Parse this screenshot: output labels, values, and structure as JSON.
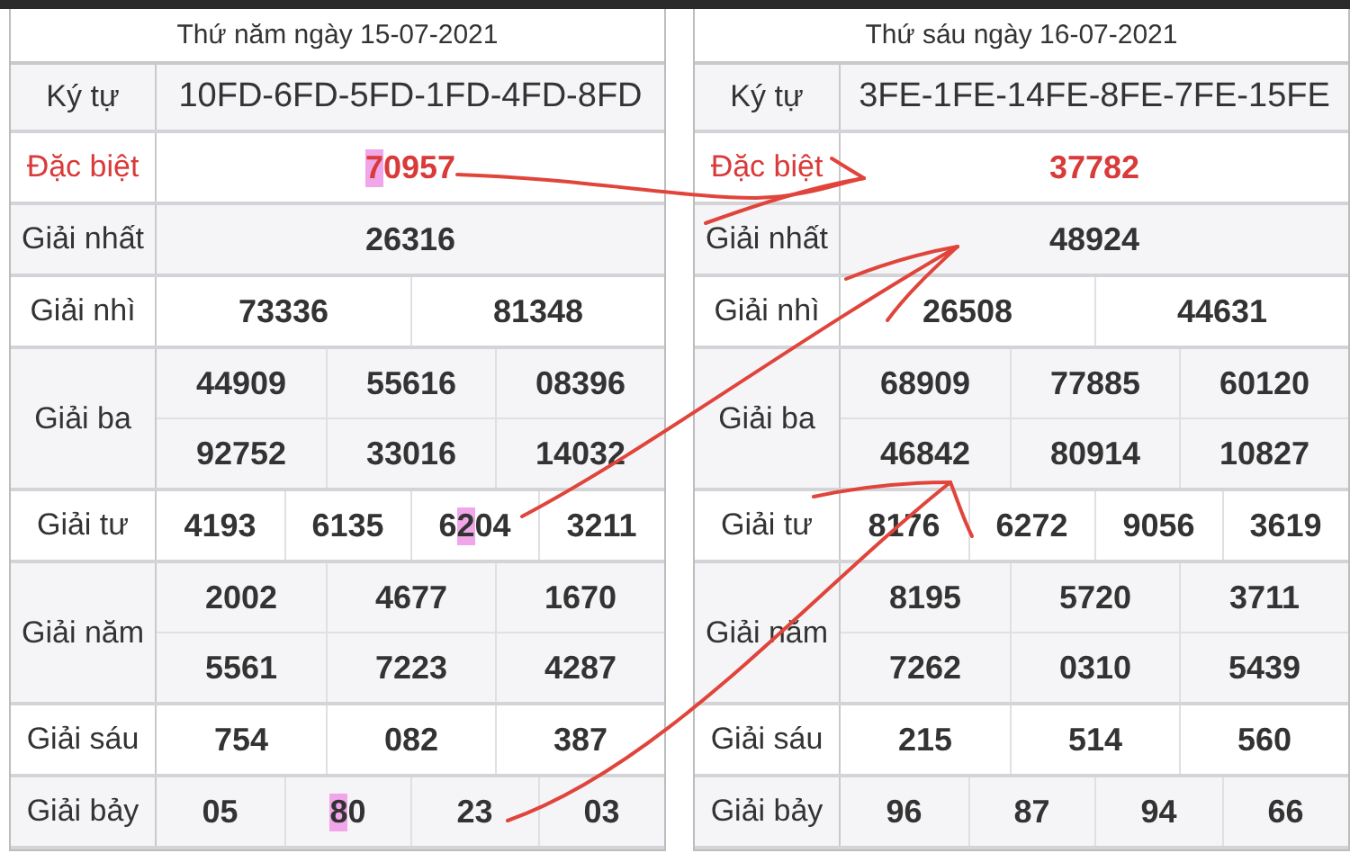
{
  "days": [
    {
      "title": "Thứ năm ngày 15-07-2021",
      "rows": [
        {
          "label": "Ký tự",
          "kind": "code",
          "lines": [
            [
              "10FD-6FD-5FD-1FD-4FD-8FD"
            ]
          ]
        },
        {
          "label": "Đặc biệt",
          "kind": "special",
          "lines": [
            [
              {
                "segments": [
                  {
                    "text": "7",
                    "highlighted": true
                  },
                  {
                    "text": "0957",
                    "highlighted": false
                  }
                ]
              }
            ]
          ]
        },
        {
          "label": "Giải nhất",
          "kind": "prize",
          "lines": [
            [
              "26316"
            ]
          ]
        },
        {
          "label": "Giải nhì",
          "kind": "prize",
          "lines": [
            [
              "73336",
              "81348"
            ]
          ]
        },
        {
          "label": "Giải ba",
          "kind": "prize",
          "lines": [
            [
              "44909",
              "55616",
              "08396"
            ],
            [
              "92752",
              "33016",
              "14032"
            ]
          ]
        },
        {
          "label": "Giải tư",
          "kind": "prize",
          "lines": [
            [
              "4193",
              "6135",
              {
                "segments": [
                  {
                    "text": "6",
                    "highlighted": false
                  },
                  {
                    "text": "2",
                    "highlighted": true
                  },
                  {
                    "text": "04",
                    "highlighted": false
                  }
                ]
              },
              "3211"
            ]
          ]
        },
        {
          "label": "Giải năm",
          "kind": "prize",
          "lines": [
            [
              "2002",
              "4677",
              "1670"
            ],
            [
              "5561",
              "7223",
              "4287"
            ]
          ]
        },
        {
          "label": "Giải sáu",
          "kind": "prize",
          "lines": [
            [
              "754",
              "082",
              "387"
            ]
          ]
        },
        {
          "label": "Giải bảy",
          "kind": "prize",
          "lines": [
            [
              "05",
              {
                "segments": [
                  {
                    "text": "8",
                    "highlighted": true
                  },
                  {
                    "text": "0",
                    "highlighted": false
                  }
                ]
              },
              "23",
              "03"
            ]
          ]
        }
      ]
    },
    {
      "title": "Thứ sáu ngày 16-07-2021",
      "rows": [
        {
          "label": "Ký tự",
          "kind": "code",
          "lines": [
            [
              "3FE-1FE-14FE-8FE-7FE-15FE"
            ]
          ]
        },
        {
          "label": "Đặc biệt",
          "kind": "special",
          "lines": [
            [
              "37782"
            ]
          ]
        },
        {
          "label": "Giải nhất",
          "kind": "prize",
          "lines": [
            [
              "48924"
            ]
          ]
        },
        {
          "label": "Giải nhì",
          "kind": "prize",
          "lines": [
            [
              "26508",
              "44631"
            ]
          ]
        },
        {
          "label": "Giải ba",
          "kind": "prize",
          "lines": [
            [
              "68909",
              "77885",
              "60120"
            ],
            [
              "46842",
              "80914",
              "10827"
            ]
          ]
        },
        {
          "label": "Giải tư",
          "kind": "prize",
          "lines": [
            [
              "8176",
              "6272",
              "9056",
              "3619"
            ]
          ]
        },
        {
          "label": "Giải năm",
          "kind": "prize",
          "lines": [
            [
              "8195",
              "5720",
              "3711"
            ],
            [
              "7262",
              "0310",
              "5439"
            ]
          ]
        },
        {
          "label": "Giải sáu",
          "kind": "prize",
          "lines": [
            [
              "215",
              "514",
              "560"
            ]
          ]
        },
        {
          "label": "Giải bảy",
          "kind": "prize",
          "lines": [
            [
              "96",
              "87",
              "94",
              "66"
            ]
          ]
        }
      ]
    }
  ]
}
